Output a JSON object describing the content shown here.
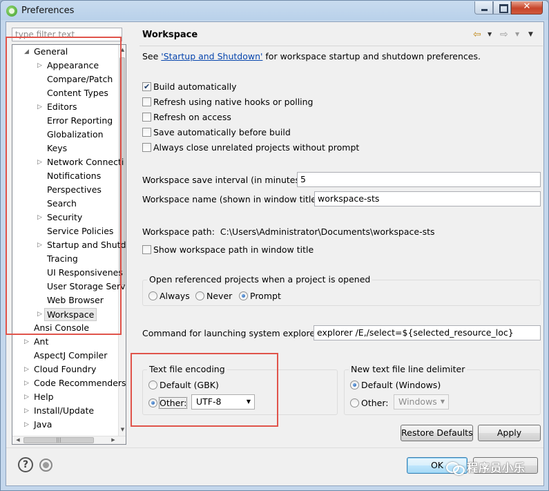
{
  "window": {
    "title": "Preferences"
  },
  "sidebar": {
    "filter_placeholder": "type filter text",
    "tree": [
      {
        "label": "General",
        "level": 0,
        "expander": "expanded"
      },
      {
        "label": "Appearance",
        "level": 1,
        "expander": "collapsed"
      },
      {
        "label": "Compare/Patch",
        "level": 1,
        "expander": "none"
      },
      {
        "label": "Content Types",
        "level": 1,
        "expander": "none"
      },
      {
        "label": "Editors",
        "level": 1,
        "expander": "collapsed"
      },
      {
        "label": "Error Reporting",
        "level": 1,
        "expander": "none"
      },
      {
        "label": "Globalization",
        "level": 1,
        "expander": "none"
      },
      {
        "label": "Keys",
        "level": 1,
        "expander": "none"
      },
      {
        "label": "Network Connecti",
        "level": 1,
        "expander": "collapsed"
      },
      {
        "label": "Notifications",
        "level": 1,
        "expander": "none"
      },
      {
        "label": "Perspectives",
        "level": 1,
        "expander": "none"
      },
      {
        "label": "Search",
        "level": 1,
        "expander": "none"
      },
      {
        "label": "Security",
        "level": 1,
        "expander": "collapsed"
      },
      {
        "label": "Service Policies",
        "level": 1,
        "expander": "none"
      },
      {
        "label": "Startup and Shutd",
        "level": 1,
        "expander": "collapsed"
      },
      {
        "label": "Tracing",
        "level": 1,
        "expander": "none"
      },
      {
        "label": "UI Responsivenes",
        "level": 1,
        "expander": "none"
      },
      {
        "label": "User Storage Serv",
        "level": 1,
        "expander": "none"
      },
      {
        "label": "Web Browser",
        "level": 1,
        "expander": "none"
      },
      {
        "label": "Workspace",
        "level": 1,
        "expander": "collapsed",
        "selected": true
      },
      {
        "label": "Ansi Console",
        "level": 0,
        "expander": "none"
      },
      {
        "label": "Ant",
        "level": 0,
        "expander": "collapsed"
      },
      {
        "label": "AspectJ Compiler",
        "level": 0,
        "expander": "none"
      },
      {
        "label": "Cloud Foundry",
        "level": 0,
        "expander": "collapsed"
      },
      {
        "label": "Code Recommenders",
        "level": 0,
        "expander": "collapsed"
      },
      {
        "label": "Help",
        "level": 0,
        "expander": "collapsed"
      },
      {
        "label": "Install/Update",
        "level": 0,
        "expander": "collapsed"
      },
      {
        "label": "Java",
        "level": 0,
        "expander": "collapsed"
      }
    ]
  },
  "page": {
    "title": "Workspace",
    "see_prefix": "See ",
    "see_link": "'Startup and Shutdown'",
    "see_suffix": " for workspace startup and shutdown preferences.",
    "checkboxes": [
      {
        "label": "Build automatically",
        "checked": true
      },
      {
        "label": "Refresh using native hooks or polling",
        "checked": false
      },
      {
        "label": "Refresh on access",
        "checked": false
      },
      {
        "label": "Save automatically before build",
        "checked": false
      },
      {
        "label": "Always close unrelated projects without prompt",
        "checked": false
      }
    ],
    "save_interval_label": "Workspace save interval (in minutes):",
    "save_interval_value": "5",
    "workspace_name_label": "Workspace name (shown in window title):",
    "workspace_name_value": "workspace-sts",
    "workspace_path_label": "Workspace path:",
    "workspace_path_value": "C:\\Users\\Administrator\\Documents\\workspace-sts",
    "show_path_label": "Show workspace path in window title",
    "open_projects": {
      "title": "Open referenced projects when a project is opened",
      "options": [
        "Always",
        "Never",
        "Prompt"
      ],
      "selected": "Prompt"
    },
    "explorer_label": "Command for launching system explorer:",
    "explorer_value": "explorer /E,/select=${selected_resource_loc}",
    "encoding": {
      "title": "Text file encoding",
      "default_label": "Default (GBK)",
      "other_label": "Other:",
      "other_value": "UTF-8",
      "selected": "Other"
    },
    "line_delimiter": {
      "title": "New text file line delimiter",
      "default_label": "Default (Windows)",
      "other_label": "Other:",
      "other_value": "Windows",
      "selected": "Default"
    },
    "restore_defaults_label": "Restore Defaults",
    "apply_label": "Apply"
  },
  "footer": {
    "ok_label": "OK",
    "watermark_text": "程序员小乐"
  },
  "colors": {
    "highlight": "#e0534a",
    "link": "#0645ad",
    "selection": "#e8e8e8"
  },
  "icons": {
    "help": "question-mark-circle",
    "record": "record-circle",
    "back": "left-arrow",
    "forward": "right-arrow"
  }
}
